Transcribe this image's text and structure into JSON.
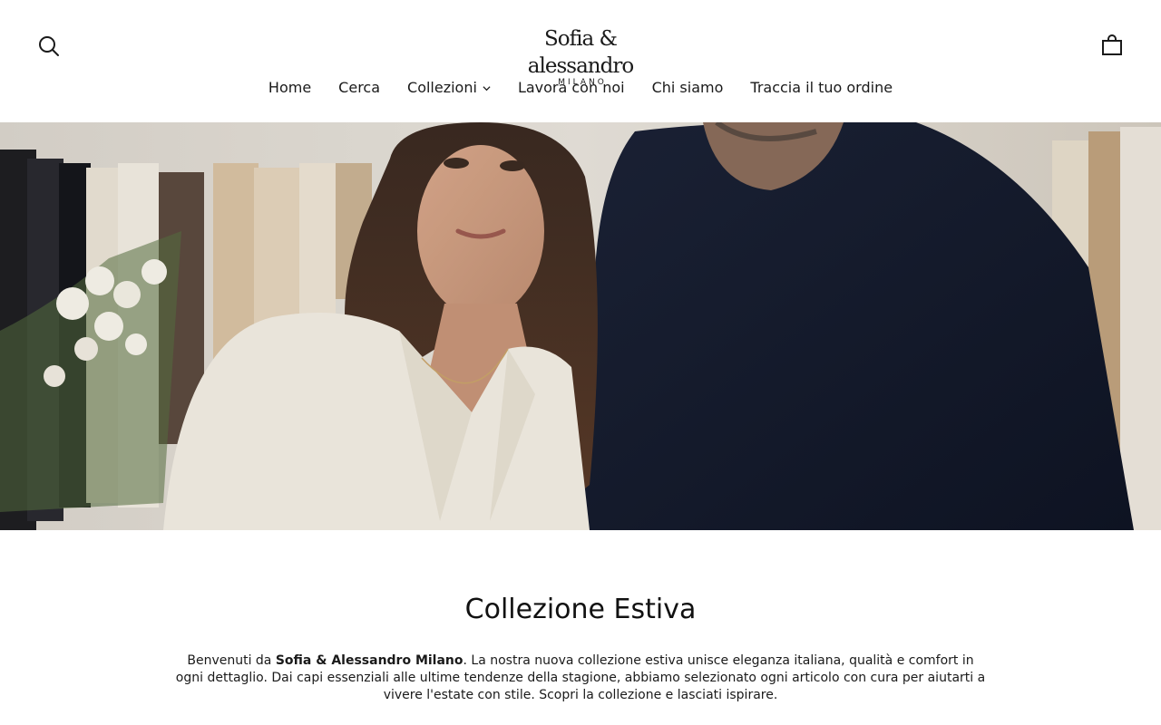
{
  "header": {
    "logo_main": "Sofia & alessandro",
    "logo_sub": "MILANO"
  },
  "nav": {
    "items": [
      {
        "label": "Home"
      },
      {
        "label": "Cerca"
      },
      {
        "label": "Collezioni"
      },
      {
        "label": "Lavora con noi"
      },
      {
        "label": "Chi siamo"
      },
      {
        "label": "Traccia il tuo ordine"
      }
    ]
  },
  "icons": {
    "search": "search-icon",
    "cart": "shopping-bag-icon",
    "dropdown": "chevron-down-icon"
  },
  "hero": {
    "description": "Photo of a smiling woman in a cream blouse and a man in a navy sweater in a clothing boutique"
  },
  "section": {
    "title": "Collezione Estiva",
    "intro_prefix": "Benvenuti da ",
    "intro_brand": "Sofia & Alessandro Milano",
    "intro_rest": ". La nostra nuova collezione estiva unisce eleganza italiana, qualità e comfort in ogni dettaglio. Dai capi essenziali alle ultime tendenze della stagione, abbiamo selezionato ogni articolo con cura per aiutarti a vivere l'estate con stile. Scopri la collezione e lasciati ispirare."
  },
  "colors": {
    "text": "#1a1a1a",
    "background": "#ffffff",
    "sweater_navy": "#141a2c",
    "blouse_cream": "#f1ece2"
  }
}
